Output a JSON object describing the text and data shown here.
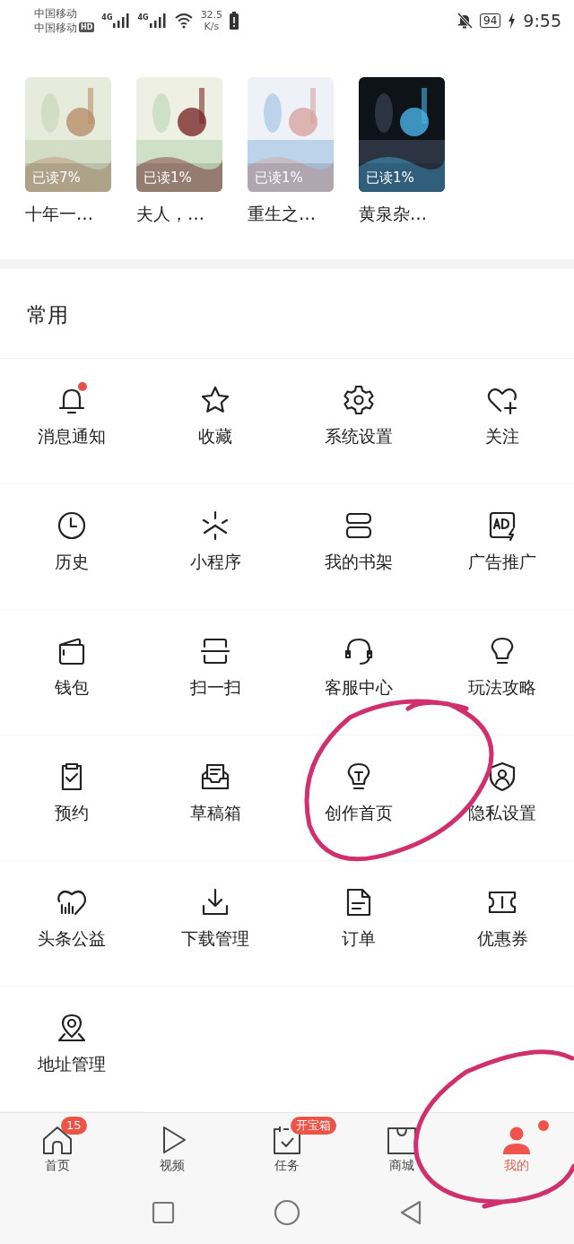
{
  "status_bar": {
    "carriers": [
      "中国移动",
      "中国移动"
    ],
    "hd": "HD",
    "networks": [
      "4G",
      "4G"
    ],
    "speed": "32.5",
    "speed_unit": "K/s",
    "battery": "94",
    "time": "9:55"
  },
  "books": [
    {
      "progress": "已读7%",
      "title": "十年一…"
    },
    {
      "progress": "已读1%",
      "title": "夫人，…"
    },
    {
      "progress": "已读1%",
      "title": "重生之…"
    },
    {
      "progress": "已读1%",
      "title": "黄泉杂…"
    }
  ],
  "common": {
    "title": "常用",
    "items": [
      {
        "label": "消息通知",
        "dot": true
      },
      {
        "label": "收藏",
        "dot": false
      },
      {
        "label": "系统设置",
        "dot": false
      },
      {
        "label": "关注",
        "dot": false
      },
      {
        "label": "历史",
        "dot": false
      },
      {
        "label": "小程序",
        "dot": false
      },
      {
        "label": "我的书架",
        "dot": false
      },
      {
        "label": "广告推广",
        "dot": false
      },
      {
        "label": "钱包",
        "dot": false
      },
      {
        "label": "扫一扫",
        "dot": false
      },
      {
        "label": "客服中心",
        "dot": false
      },
      {
        "label": "玩法攻略",
        "dot": false
      },
      {
        "label": "预约",
        "dot": false
      },
      {
        "label": "草稿箱",
        "dot": false
      },
      {
        "label": "创作首页",
        "dot": false
      },
      {
        "label": "隐私设置",
        "dot": false
      },
      {
        "label": "头条公益",
        "dot": false
      },
      {
        "label": "下载管理",
        "dot": false
      },
      {
        "label": "订单",
        "dot": false
      },
      {
        "label": "优惠券",
        "dot": false
      },
      {
        "label": "地址管理",
        "dot": false
      }
    ]
  },
  "tab_bar": [
    {
      "label": "首页",
      "selected": false,
      "badge": "15",
      "dot": false
    },
    {
      "label": "视频",
      "selected": false,
      "dot": false
    },
    {
      "label": "任务",
      "selected": false,
      "badge": "开宝箱",
      "dot": false
    },
    {
      "label": "商城",
      "selected": false,
      "dot": false
    },
    {
      "label": "我的",
      "selected": true,
      "dot": true
    }
  ],
  "annotations": [
    {
      "kind": "circle",
      "color": "#d0306e"
    },
    {
      "kind": "circle",
      "color": "#d0306e"
    }
  ]
}
